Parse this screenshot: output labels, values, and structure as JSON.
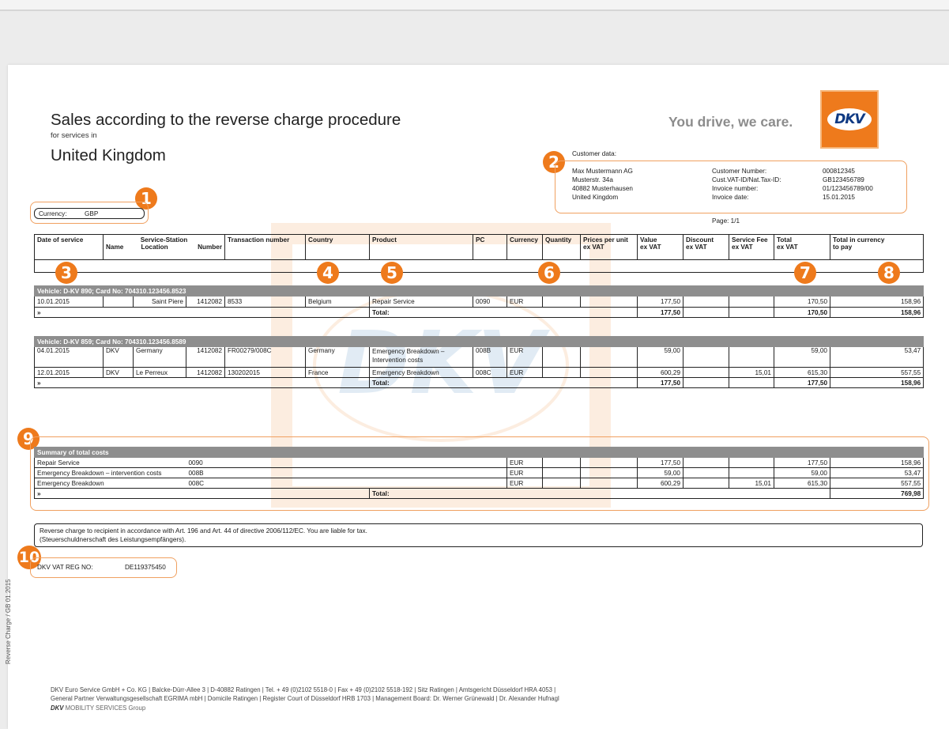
{
  "header": {
    "title": "Sales according to the reverse charge procedure",
    "subtitle": "for services in",
    "country": "United Kingdom",
    "slogan": "You drive, we care.",
    "logo_text": "DKV"
  },
  "badges": [
    "1",
    "2",
    "3",
    "4",
    "5",
    "6",
    "7",
    "8",
    "9",
    "10"
  ],
  "currency": {
    "label": "Currency:",
    "value": "GBP"
  },
  "customer": {
    "label": "Customer data:",
    "address": [
      "Max Mustermann AG",
      "Musterstr. 34a",
      "40882 Musterhausen",
      "United Kingdom"
    ],
    "field_labels": [
      "Customer Number:",
      "Cust.VAT-ID/Nat.Tax-ID:",
      "Invoice number:",
      "Invoice date:"
    ],
    "field_values": [
      "000812345",
      "GB123456789",
      "01/123456789/00",
      "15.01.2015"
    ],
    "page": "Page: 1/1"
  },
  "table_headers": {
    "date": "Date of service",
    "station": "Service-Station",
    "name": "Name",
    "location": "Location",
    "number": "Number",
    "transaction": "Transaction number",
    "country": "Country",
    "product": "Product",
    "pc": "PC",
    "currency": "Currency",
    "quantity": "Quantity",
    "price1": "Prices per unit",
    "price2": "ex VAT",
    "value1": "Value",
    "value2": "ex VAT",
    "discount1": "Discount",
    "discount2": "ex VAT",
    "fee1": "Service Fee",
    "fee2": "ex VAT",
    "total1": "Total",
    "total2": "ex VAT",
    "topay1": "Total in currency",
    "topay2": "to pay"
  },
  "vehicles": [
    {
      "title": "Vehicle: D-KV 890; Card No: 704310.123456.8523",
      "rows": [
        {
          "date": "10.01.2015",
          "name": "",
          "location": "Saint Piere",
          "number": "1412082",
          "transaction": "8533",
          "country": "Belgium",
          "product": "Repair Service",
          "product2": "",
          "pc": "0090",
          "currency": "EUR",
          "quantity": "",
          "price": "",
          "value": "177,50",
          "discount": "",
          "fee": "",
          "total": "170,50",
          "topay": "158,96"
        }
      ],
      "total": {
        "marker": "»",
        "label": "Total:",
        "value": "177,50",
        "total": "170,50",
        "topay": "158,96"
      }
    },
    {
      "title": "Vehicle: D-KV 859; Card No: 704310.123456.8589",
      "rows": [
        {
          "date": "04.01.2015",
          "name": "DKV",
          "location": "Germany",
          "number": "1412082",
          "transaction": "FR00279/008C",
          "country": "Germany",
          "product": "Emergency Breakdown –",
          "product2": "Intervention costs",
          "pc": "008B",
          "currency": "EUR",
          "quantity": "",
          "price": "",
          "value": "59,00",
          "discount": "",
          "fee": "",
          "total": "59,00",
          "topay": "53,47"
        },
        {
          "date": "12.01.2015",
          "name": "DKV",
          "location": "Le Perreux",
          "number": "1412082",
          "transaction": "130202015",
          "country": "France",
          "product": "Emergency Breakdown",
          "product2": "",
          "pc": "008C",
          "currency": "EUR",
          "quantity": "",
          "price": "",
          "value": "600,29",
          "discount": "",
          "fee": "15,01",
          "total": "615,30",
          "topay": "557,55"
        }
      ],
      "total": {
        "marker": "»",
        "label": "Total:",
        "value": "177,50",
        "total": "177,50",
        "topay": "158,96"
      }
    }
  ],
  "summary": {
    "title": "Summary of total costs",
    "rows": [
      {
        "product": "Repair Service",
        "pc": "0090",
        "currency": "EUR",
        "value": "177,50",
        "fee": "",
        "total": "177,50",
        "topay": "158,96"
      },
      {
        "product": "Emergency Breakdown – intervention costs",
        "pc": "008B",
        "currency": "EUR",
        "value": "59,00",
        "fee": "",
        "total": "59,00",
        "topay": "53,47"
      },
      {
        "product": "Emergency Breakdown",
        "pc": "008C",
        "currency": "EUR",
        "value": "600,29",
        "fee": "15,01",
        "total": "615,30",
        "topay": "557,55"
      }
    ],
    "total": {
      "marker": "»",
      "label": "Total:",
      "topay": "769,98"
    }
  },
  "reverse_charge": {
    "line1": "Reverse charge to recipient in accordance with Art. 196 and Art. 44 of directive 2006/112/EC. You are liable for tax.",
    "line2": "(Steuerschuldnerschaft des Leistungsempfängers)."
  },
  "vat": {
    "label": "DKV VAT REG NO:",
    "value": "DE119375450"
  },
  "side_text": "Reverse Charge / GB 01.2015",
  "footer": {
    "line1": "DKV Euro Service GmbH + Co. KG | Balcke-Dürr-Allee 3 | D-40882 Ratingen | Tel. + 49 (0)2102 5518-0 | Fax + 49 (0)2102 5518-192 | Sitz Ratingen | Amtsgericht Düsseldorf HRA 4053 |",
    "line2": "General Partner Verwaltungsgesellschaft EGRIMA mbH | Domicile Ratingen | Register Court of Düsseldorf HRB 1703 | Management Board: Dr. Werner Grünewald | Dr. Alexander Hufnagl",
    "brand": "DKV",
    "group": "MOBILITY SERVICES Group"
  }
}
